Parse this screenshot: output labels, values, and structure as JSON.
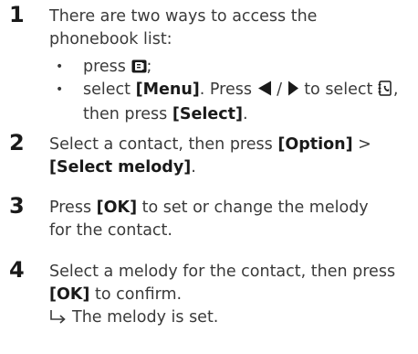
{
  "steps": [
    {
      "number": "1",
      "text_line1": "There are two ways to access the",
      "text_line2": "phonebook list:",
      "bullets": [
        {
          "pre": "press",
          "post": ";"
        },
        {
          "pre": "select",
          "menu": "[Menu]",
          "mid": ". Press",
          "slash": "/",
          "to_select": "to select",
          "comma": ",",
          "then": "then press",
          "select": "[Select]",
          "end": "."
        }
      ]
    },
    {
      "number": "2",
      "line1_pre": "Select a contact, then press",
      "option": "[Option]",
      "gt": ">",
      "select_melody": "[Select melody]",
      "end": "."
    },
    {
      "number": "3",
      "pre": "Press",
      "ok": "[OK]",
      "line1_post": "to set or change the melody",
      "line2": "for the contact."
    },
    {
      "number": "4",
      "line1": "Select a melody for the contact, then press",
      "ok": "[OK]",
      "line2_post": "to confirm.",
      "result": "The melody is set."
    }
  ],
  "icons": {
    "phonebook_key": "phonebook-key-icon",
    "left_arrow": "left-triangle-icon",
    "right_arrow": "right-triangle-icon",
    "phonebook_menu": "phonebook-menu-icon",
    "result_arrow": "result-arrow-icon"
  }
}
